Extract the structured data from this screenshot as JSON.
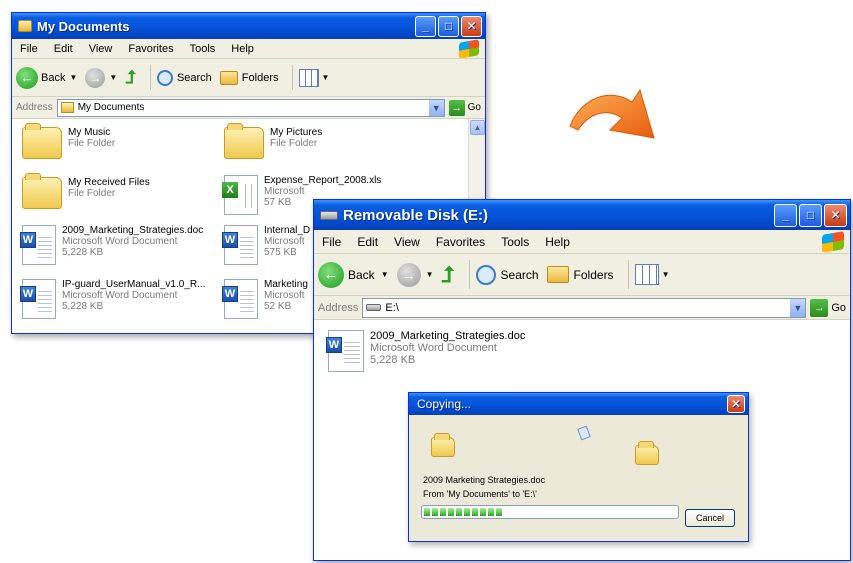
{
  "colors": {
    "accent_orange": "#f07a1a"
  },
  "window1": {
    "title": "My Documents",
    "menu": [
      "File",
      "Edit",
      "View",
      "Favorites",
      "Tools",
      "Help"
    ],
    "toolbar": {
      "back": "Back",
      "search": "Search",
      "folders": "Folders"
    },
    "address_label": "Address",
    "address_value": "My Documents",
    "go_label": "Go",
    "items": [
      {
        "name": "My Music",
        "sub1": "File Folder",
        "sub2": "",
        "icon": "music-folder-icon"
      },
      {
        "name": "My Pictures",
        "sub1": "File Folder",
        "sub2": "",
        "icon": "pictures-folder-icon"
      },
      {
        "name": "My Received Files",
        "sub1": "File Folder",
        "sub2": "",
        "icon": "folder-icon"
      },
      {
        "name": "Expense_Report_2008.xls",
        "sub1": "Microsoft",
        "sub2": "57 KB",
        "icon": "excel-file-icon"
      },
      {
        "name": "2009_Marketing_Strategies.doc",
        "sub1": "Microsoft Word Document",
        "sub2": "5,228 KB",
        "icon": "word-file-icon"
      },
      {
        "name": "Internal_D",
        "sub1": "Microsoft",
        "sub2": "575 KB",
        "icon": "word-file-icon"
      },
      {
        "name": "IP-guard_UserManual_v1.0_R...",
        "sub1": "Microsoft Word Document",
        "sub2": "5,228 KB",
        "icon": "word-file-icon"
      },
      {
        "name": "Marketing",
        "sub1": "Microsoft",
        "sub2": "52 KB",
        "icon": "word-file-icon"
      }
    ]
  },
  "window2": {
    "title": "Removable Disk (E:)",
    "menu": [
      "File",
      "Edit",
      "View",
      "Favorites",
      "Tools",
      "Help"
    ],
    "toolbar": {
      "back": "Back",
      "search": "Search",
      "folders": "Folders"
    },
    "address_label": "Address",
    "address_value": "E:\\",
    "go_label": "Go",
    "file": {
      "name": "2009_Marketing_Strategies.doc",
      "sub1": "Microsoft Word Document",
      "sub2": "5,228 KB"
    }
  },
  "dialog": {
    "title": "Copying...",
    "filename": "2009 Marketing Strategies.doc",
    "from_to": "From 'My Documents' to 'E:\\'",
    "progress": 0.35,
    "cancel": "Cancel"
  }
}
